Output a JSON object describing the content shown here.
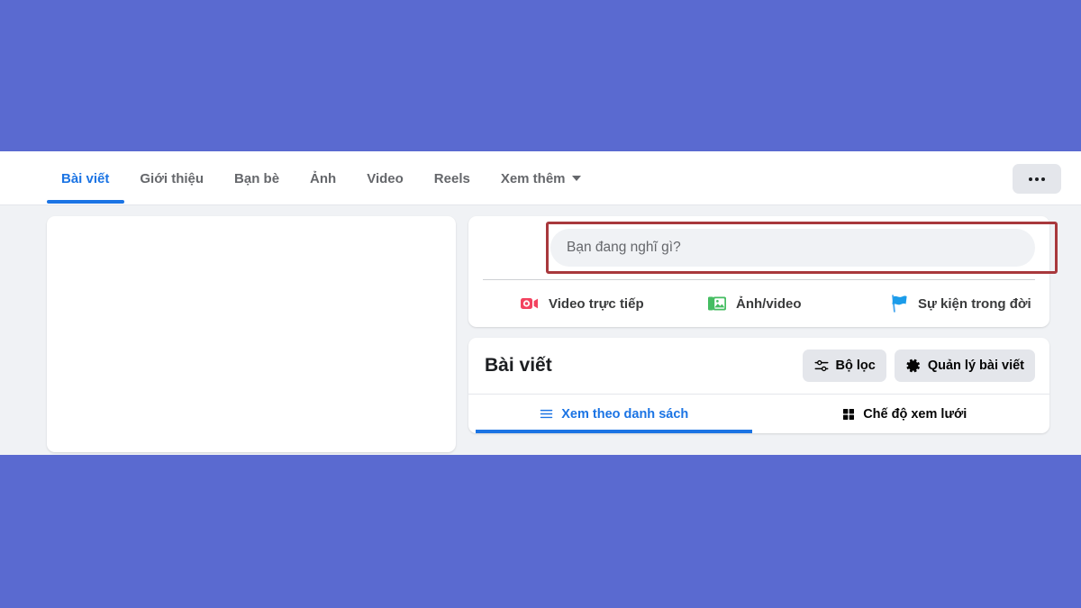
{
  "theme": {
    "page_background": "#5a6ad0",
    "surface": "#ffffff",
    "app_background": "#f0f2f5",
    "accent_blue": "#1b74e4",
    "annotation_red": "#a8383c",
    "muted_text": "#65676b",
    "chip_background": "#e4e6eb"
  },
  "nav": {
    "tabs": [
      {
        "label": "Bài viết",
        "active": true
      },
      {
        "label": "Giới thiệu",
        "active": false
      },
      {
        "label": "Bạn bè",
        "active": false
      },
      {
        "label": "Ảnh",
        "active": false
      },
      {
        "label": "Video",
        "active": false
      },
      {
        "label": "Reels",
        "active": false
      },
      {
        "label": "Xem thêm",
        "active": false,
        "has_caret": true
      }
    ],
    "more_button": {
      "icon": "ellipsis-icon"
    }
  },
  "composer": {
    "placeholder": "Bạn đang nghĩ gì?",
    "value": "",
    "highlighted": true,
    "actions": [
      {
        "label": "Video trực tiếp",
        "icon": "live-video-icon",
        "color": "#f3425f"
      },
      {
        "label": "Ảnh/video",
        "icon": "photo-video-icon",
        "color": "#45bd62"
      },
      {
        "label": "Sự kiện trong đời",
        "icon": "life-event-flag-icon",
        "color": "#1b9cea"
      }
    ]
  },
  "posts": {
    "title": "Bài viết",
    "buttons": [
      {
        "label": "Bộ lọc",
        "icon": "filter-sliders-icon"
      },
      {
        "label": "Quản lý bài viết",
        "icon": "gear-icon"
      }
    ],
    "view_tabs": [
      {
        "label": "Xem theo danh sách",
        "icon": "list-view-icon",
        "active": true
      },
      {
        "label": "Chế độ xem lưới",
        "icon": "grid-view-icon",
        "active": false
      }
    ]
  },
  "left_panel": {
    "content": ""
  }
}
